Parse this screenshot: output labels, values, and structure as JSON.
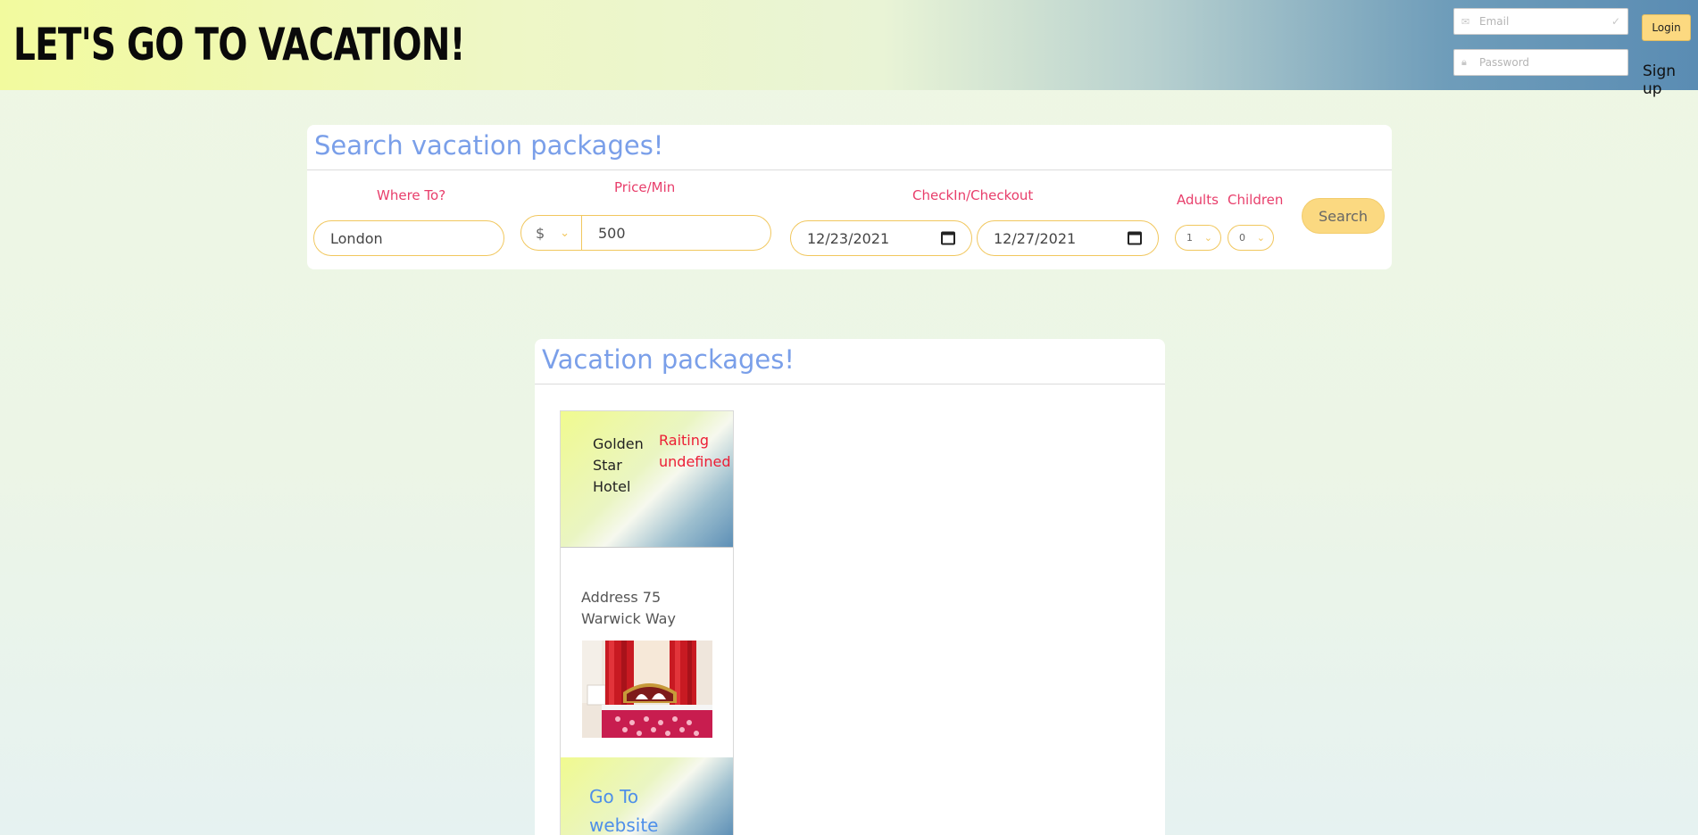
{
  "header": {
    "title": "LET'S GO TO VACATION!",
    "email_placeholder": "Email",
    "password_placeholder": "Password",
    "login_label": "Login",
    "signup_label": "Sign up"
  },
  "search": {
    "title": "Search vacation packages!",
    "where_label": "Where To?",
    "where_value": "London",
    "price_label": "Price/Min",
    "currency": "$",
    "price_value": "500",
    "dates_label": "CheckIn/Checkout",
    "checkin": "12/23/2021",
    "checkout": "12/27/2021",
    "adults_label": "Adults",
    "adults_value": "1",
    "children_label": "Children",
    "children_value": "0",
    "search_label": "Search"
  },
  "results": {
    "title": "Vacation packages!",
    "cards": [
      {
        "name": "Golden Star Hotel",
        "rating": "Raiting undefined",
        "address": "Address 75 Warwick Way",
        "link_label": "Go To website"
      }
    ]
  },
  "colors": {
    "accent_blue": "#7a9fe9",
    "label_pink": "#e83e6b",
    "button_yellow": "#fbd981",
    "rating_red": "#ec1e35"
  },
  "icons": [
    "envelope-icon",
    "check-icon",
    "lock-icon",
    "chevron-down-icon",
    "calendar-icon"
  ]
}
